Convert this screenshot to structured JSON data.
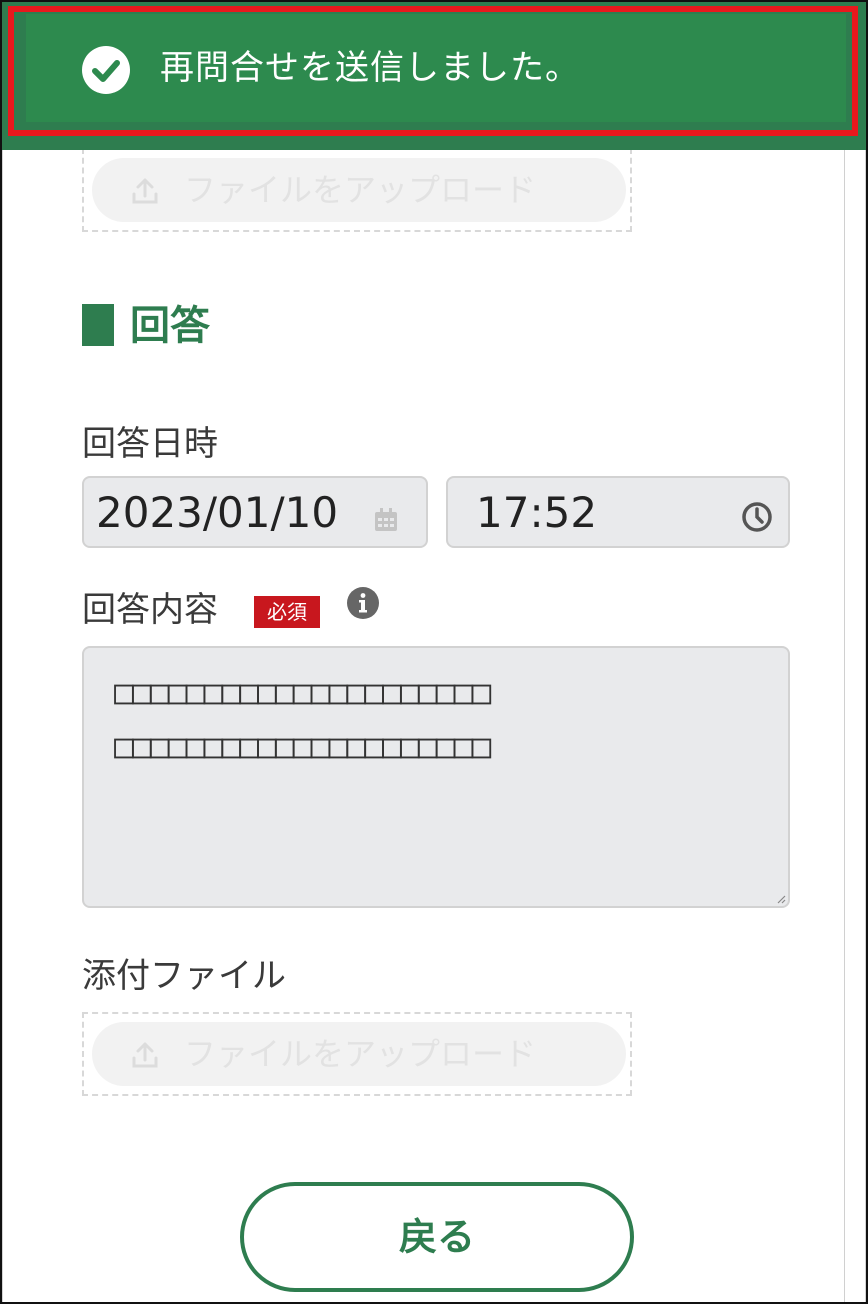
{
  "toast": {
    "message": "再問合せを送信しました。",
    "icon": "check-circle-icon",
    "color": "#2d8a4e",
    "highlight_color": "#e8191d"
  },
  "question": {
    "upload_label": "ファイルをアップロード"
  },
  "answer": {
    "section_title": "回答",
    "datetime_label": "回答日時",
    "date_value": "2023/01/10",
    "time_value": "17:52",
    "content_label": "回答内容",
    "required_badge": "必須",
    "content_lines": [
      "□□□□□□□□□□□□□□□□□□□□□",
      "□□□□□□□□□□□□□□□□□□□□□"
    ],
    "attachment_label": "添付ファイル",
    "upload_label": "ファイルをアップロード"
  },
  "footer": {
    "back_label": "戻る"
  },
  "colors": {
    "accent": "#2e7d4f",
    "required": "#c8171e",
    "input_bg": "#e9eaec"
  }
}
